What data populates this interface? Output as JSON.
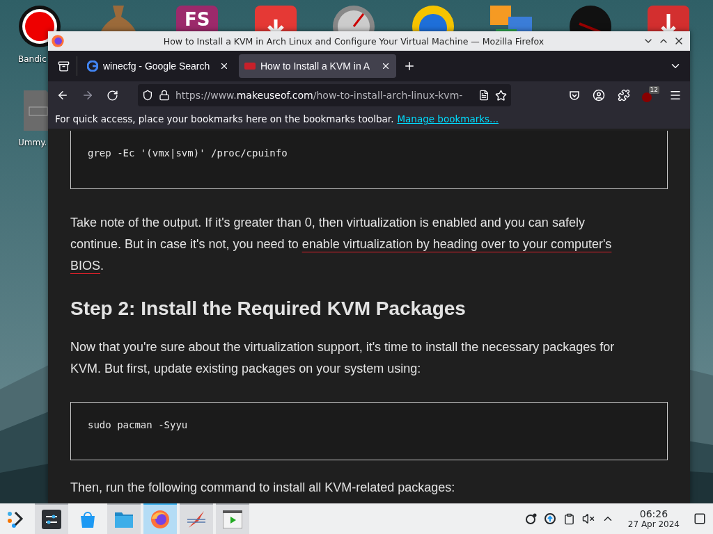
{
  "desktop": {
    "fs_glyph": "FS",
    "labels": [
      {
        "text": "Bandic"
      },
      {
        "text": "Ummy."
      }
    ]
  },
  "window": {
    "title": "How to Install a KVM in Arch Linux and Configure Your Virtual Machine — Mozilla Firefox"
  },
  "tabs": [
    {
      "label": "winecfg - Google Search",
      "selected": false
    },
    {
      "label": "How to Install a KVM in A",
      "selected": true
    }
  ],
  "address_bar": {
    "prefix": "https://www.",
    "domain": "makeuseof.com",
    "path": "/how-to-install-arch-linux-kvm-"
  },
  "extension_badge": "12",
  "bookmarks_bar": {
    "text": "For quick access, place your bookmarks here on the bookmarks toolbar.",
    "link": "Manage bookmarks..."
  },
  "article": [
    {
      "kind": "code",
      "text": "grep -Ec '(vmx|svm)' /proc/cpuinfo"
    },
    {
      "kind": "paragraph",
      "parts": [
        {
          "kind": "text",
          "text": "Take note of the output. If it's greater than 0, then virtualization is enabled and you can safely continue. But in case it's not, you need to "
        },
        {
          "kind": "link",
          "text": "enable virtualization by heading over to your computer's"
        },
        {
          "kind": "link",
          "text": "BIOS"
        },
        {
          "kind": "text",
          "text": "."
        }
      ]
    },
    {
      "kind": "heading",
      "text": "Step 2: Install the Required KVM Packages"
    },
    {
      "kind": "paragraph",
      "parts": [
        {
          "kind": "text",
          "text": "Now that you're sure about the virtualization support, it's time to install the necessary packages for KVM. But first, update existing packages on your system using:"
        }
      ]
    },
    {
      "kind": "code",
      "text": "sudo pacman -Syyu"
    },
    {
      "kind": "paragraph",
      "parts": [
        {
          "kind": "text",
          "text": "Then, run the following command to install all KVM-related packages:"
        }
      ]
    }
  ],
  "taskbar": {
    "apps": [
      {
        "open": true,
        "selected": false
      },
      {
        "open": false,
        "selected": false
      },
      {
        "open": true,
        "selected": false
      },
      {
        "open": true,
        "selected": true
      },
      {
        "open": true,
        "selected": false
      },
      {
        "open": true,
        "selected": false
      }
    ],
    "time": "06:26",
    "date": "27 Apr 2024"
  }
}
